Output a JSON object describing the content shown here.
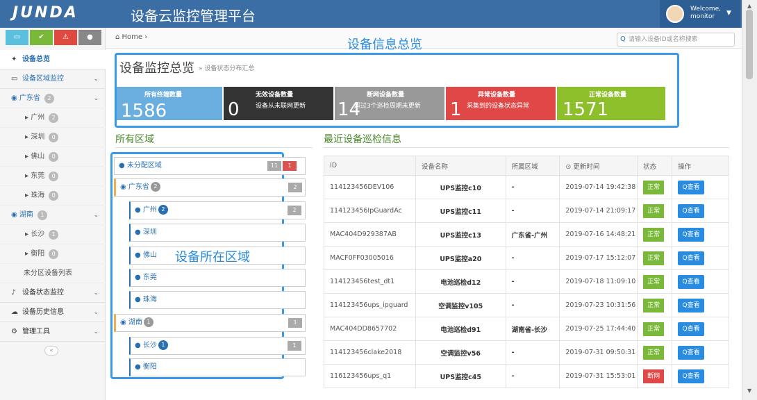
{
  "header": {
    "logo": "JUNDA",
    "title": "设备云监控管理平台",
    "welcome": "Welcome,",
    "user": "monitor"
  },
  "sidebar": {
    "buttons": [
      "▭",
      "✔",
      "⚠",
      "●"
    ],
    "items": [
      {
        "label": "设备总览"
      },
      {
        "label": "设备区域监控"
      },
      {
        "label": "广东省",
        "count": "2"
      },
      {
        "label": "广州",
        "count": "2"
      },
      {
        "label": "深圳",
        "count": "0"
      },
      {
        "label": "佛山",
        "count": "0"
      },
      {
        "label": "东莞",
        "count": "0"
      },
      {
        "label": "珠海",
        "count": "0"
      },
      {
        "label": "湖南",
        "count": "1"
      },
      {
        "label": "长沙",
        "count": "1"
      },
      {
        "label": "衡阳",
        "count": "0"
      },
      {
        "label": "未分区设备列表"
      },
      {
        "label": "设备状态监控"
      },
      {
        "label": "设备历史信息"
      },
      {
        "label": "管理工具"
      }
    ]
  },
  "breadcrumb": {
    "home": "Home"
  },
  "search": {
    "placeholder": "请输入设备ID或名称搜索"
  },
  "annotations": {
    "overview": "设备信息总览",
    "region_area": "设备所在区域"
  },
  "page": {
    "title": "设备监控总览",
    "subtitle": "» 设备状态分布汇总"
  },
  "stats": [
    {
      "label": "所有终端数量",
      "desc": "",
      "value": "1586",
      "color": "#6aaee0"
    },
    {
      "label": "无效设备数量",
      "desc": "设备从未联网更新",
      "value": "0",
      "color": "#333333"
    },
    {
      "label": "断网设备数量",
      "desc": "超过3个巡检周期未更新",
      "value": "14",
      "color": "#999999"
    },
    {
      "label": "异常设备数量",
      "desc": "采集到的设备状态异常",
      "value": "1",
      "color": "#e04848"
    },
    {
      "label": "正常设备数量",
      "desc": "",
      "value": "1571",
      "color": "#8cbf2a"
    }
  ],
  "regions_title": "所有区域",
  "regions": [
    {
      "label": "未分配区域",
      "badge": "",
      "tag1": "11",
      "tag2": "1"
    },
    {
      "label": "广东省",
      "badge": "2",
      "tag1": "2",
      "tag2": ""
    },
    {
      "label": "广州",
      "badge": "2",
      "tag1": "2",
      "tag2": ""
    },
    {
      "label": "深圳",
      "badge": "",
      "tag1": "",
      "tag2": ""
    },
    {
      "label": "佛山",
      "badge": "",
      "tag1": "",
      "tag2": ""
    },
    {
      "label": "东莞",
      "badge": "",
      "tag1": "",
      "tag2": ""
    },
    {
      "label": "珠海",
      "badge": "",
      "tag1": "",
      "tag2": ""
    },
    {
      "label": "湖南",
      "badge": "1",
      "tag1": "1",
      "tag2": ""
    },
    {
      "label": "长沙",
      "badge": "1",
      "tag1": "1",
      "tag2": ""
    },
    {
      "label": "衡阳",
      "badge": "",
      "tag1": "",
      "tag2": ""
    }
  ],
  "inspection_title": "最近设备巡检信息",
  "table": {
    "headers": [
      "ID",
      "设备名称",
      "所属区域",
      "⊙ 更新时间",
      "状态",
      "操作"
    ],
    "view_label": "Q查看",
    "rows": [
      {
        "id": "114123456DEV106",
        "name": "UPS监控c10",
        "area": "-",
        "time": "2019-07-14 19:42:38",
        "status": "正常",
        "status_color": "#7ab83a"
      },
      {
        "id": "114123456IpGuardAc",
        "name": "UPS监控c11",
        "area": "-",
        "time": "2019-07-14 21:09:17",
        "status": "正常",
        "status_color": "#7ab83a"
      },
      {
        "id": "MAC404D929387AB",
        "name": "UPS监控c13",
        "area": "广东省-广州",
        "time": "2019-07-16 14:48:21",
        "status": "正常",
        "status_color": "#7ab83a"
      },
      {
        "id": "MACF0FF03005016",
        "name": "UPS监控a20",
        "area": "-",
        "time": "2019-07-17 15:12:07",
        "status": "正常",
        "status_color": "#7ab83a"
      },
      {
        "id": "114123456test_dt1",
        "name": "电池巡检d12",
        "area": "-",
        "time": "2019-07-18 11:09:10",
        "status": "正常",
        "status_color": "#7ab83a"
      },
      {
        "id": "114123456ups_ipguard",
        "name": "空调监控v105",
        "area": "-",
        "time": "2019-07-23 10:31:56",
        "status": "正常",
        "status_color": "#7ab83a"
      },
      {
        "id": "MAC404DD8657702",
        "name": "电池巡检d91",
        "area": "湖南省-长沙",
        "time": "2019-07-25 17:44:40",
        "status": "正常",
        "status_color": "#7ab83a"
      },
      {
        "id": "114123456clake2018",
        "name": "空调监控v56",
        "area": "-",
        "time": "2019-07-31 09:50:31",
        "status": "正常",
        "status_color": "#7ab83a"
      },
      {
        "id": "116123456ups_q1",
        "name": "UPS监控c45",
        "area": "-",
        "time": "2019-07-31 15:53:01",
        "status": "断网",
        "status_color": "#e04848"
      }
    ]
  }
}
